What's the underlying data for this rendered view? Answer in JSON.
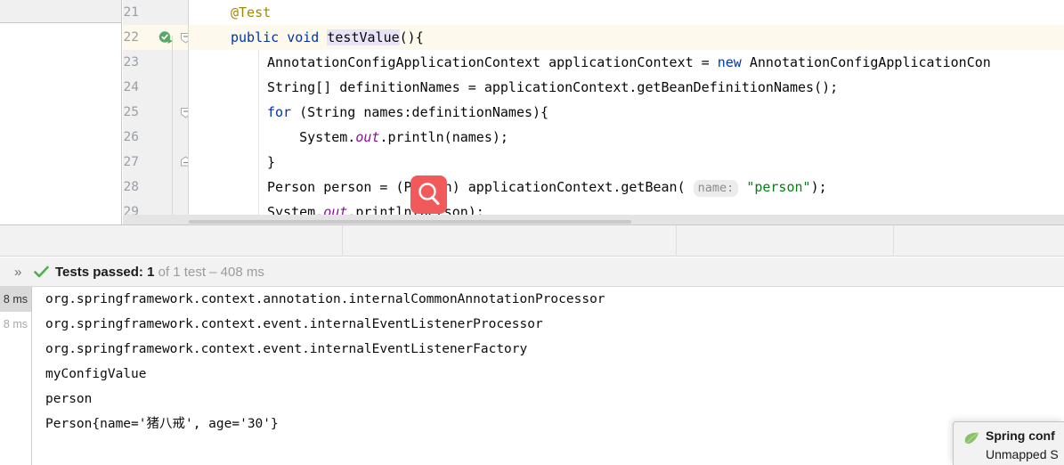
{
  "editor": {
    "gutter": {
      "lines": [
        {
          "num": "21",
          "current": false,
          "run_icon": false,
          "fold": false
        },
        {
          "num": "22",
          "current": true,
          "run_icon": true,
          "fold": true
        },
        {
          "num": "23",
          "current": false,
          "run_icon": false,
          "fold": false
        },
        {
          "num": "24",
          "current": false,
          "run_icon": false,
          "fold": false
        },
        {
          "num": "25",
          "current": false,
          "run_icon": false,
          "fold": true
        },
        {
          "num": "26",
          "current": false,
          "run_icon": false,
          "fold": false
        },
        {
          "num": "27",
          "current": false,
          "run_icon": false,
          "fold": true
        },
        {
          "num": "28",
          "current": false,
          "run_icon": false,
          "fold": false
        },
        {
          "num": "29",
          "current": false,
          "run_icon": false,
          "fold": false
        }
      ]
    },
    "code_lines": [
      "@Test",
      "public void testValue(){",
      "    AnnotationConfigApplicationContext applicationContext = new AnnotationConfigApplicationCon",
      "    String[] definitionNames = applicationContext.getBeanDefinitionNames();",
      "    for (String names:definitionNames){",
      "        System.out.println(names);",
      "    }",
      "    Person person = (Person) applicationContext.getBean( name: \"person\");",
      "    System.out.println(person);"
    ],
    "cursor_icon": "magnifier-icon"
  },
  "run_window": {
    "status": {
      "expand_icon": "chevron-double-right-icon",
      "result_icon": "check-mark-icon",
      "label": "Tests passed:",
      "count": "1",
      "detail": "of 1 test – 408 ms"
    },
    "duration_column": [
      {
        "value": "8 ms",
        "selected": true
      },
      {
        "value": "8 ms",
        "selected": false
      }
    ],
    "console_lines": [
      "org.springframework.context.annotation.internalCommonAnnotationProcessor",
      "org.springframework.context.event.internalEventListenerProcessor",
      "org.springframework.context.event.internalEventListenerFactory",
      "myConfigValue",
      "person",
      "Person{name='猪八戒', age='30'}"
    ]
  },
  "notification": {
    "icon": "spring-leaf-icon",
    "title": "Spring conf",
    "subtitle": "Unmapped S"
  },
  "colors": {
    "keyword": "#0033b3",
    "annotation": "#9e880d",
    "string": "#067d17",
    "field": "#871094",
    "current_line": "#fdf9ec",
    "method_highlight": "#e8e3f7",
    "cursor_red": "#f05a5a",
    "pass_green": "#4caf50"
  }
}
